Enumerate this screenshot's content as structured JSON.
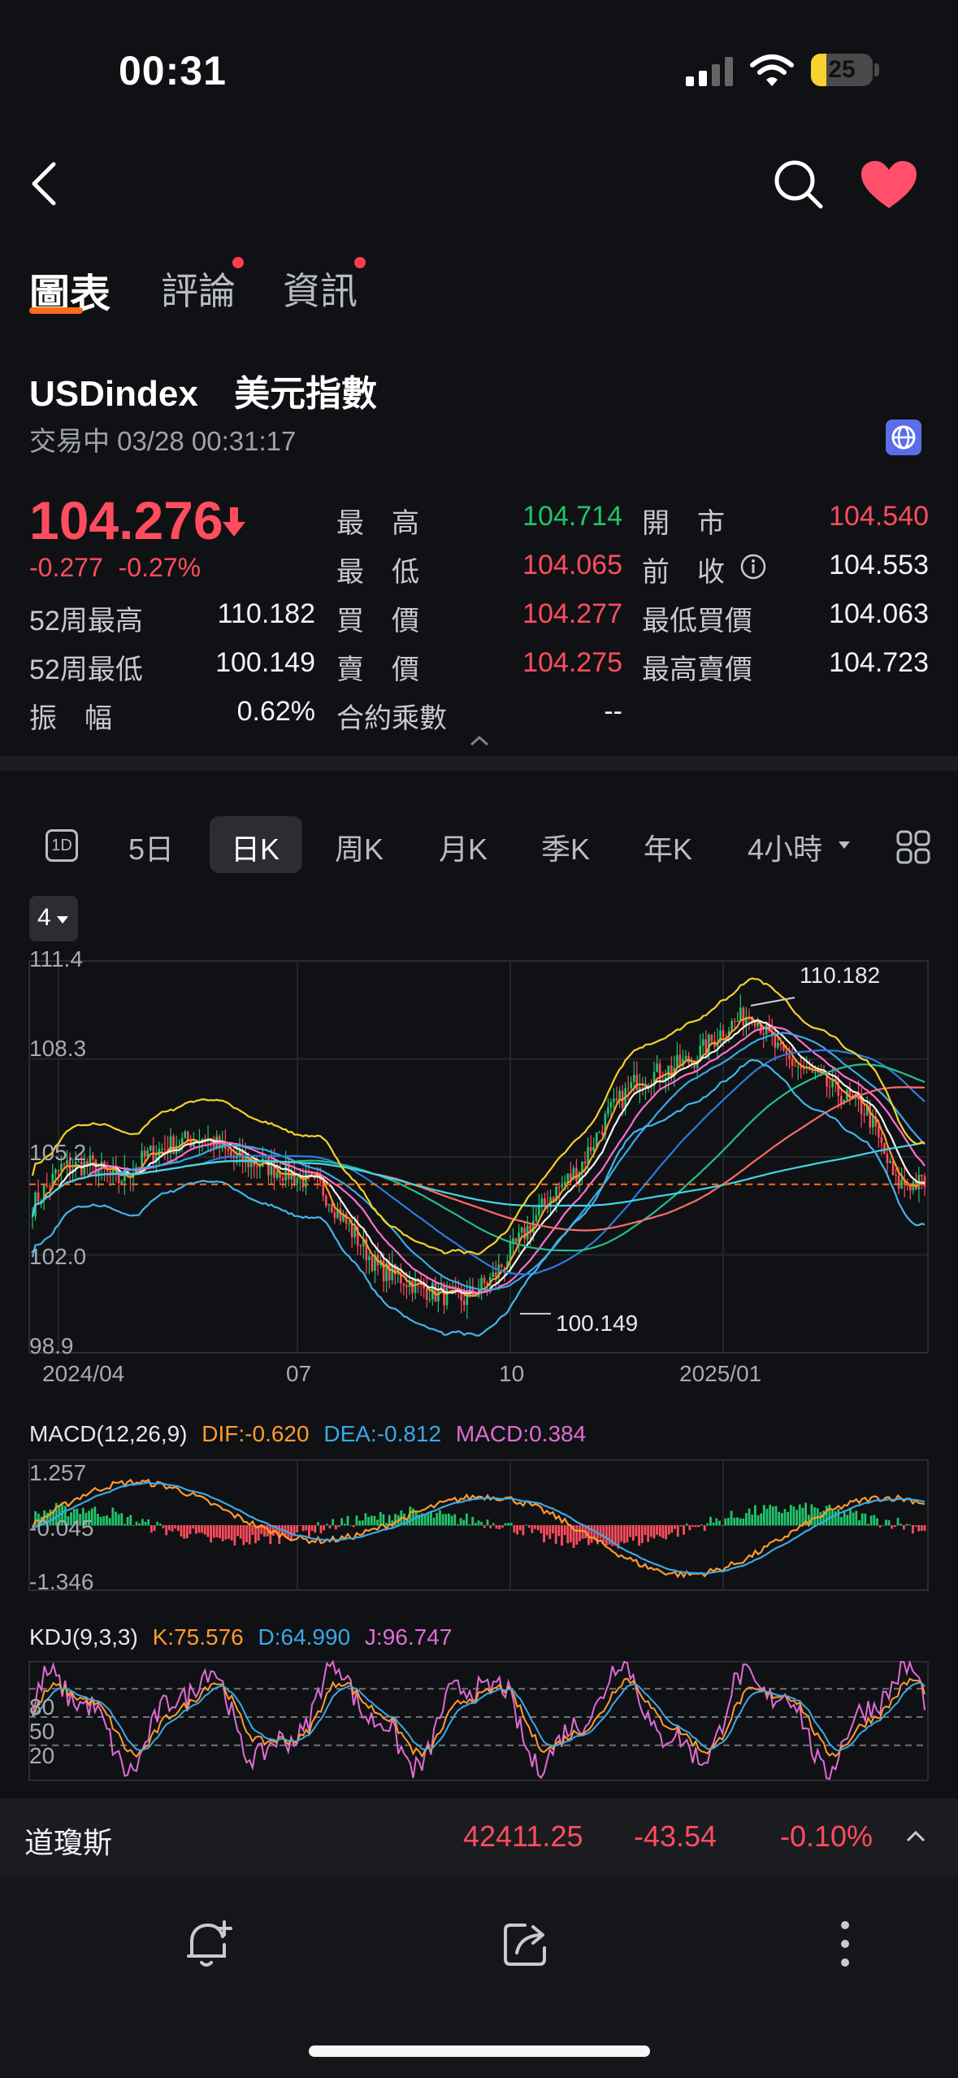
{
  "status": {
    "time": "00:31",
    "battery": "25",
    "battery_level": 0.25
  },
  "nav": {
    "tabs": [
      {
        "label": "圖表"
      },
      {
        "label": "評論"
      },
      {
        "label": "資訊"
      }
    ]
  },
  "instrument": {
    "symbol": "USDindex",
    "name": "美元指數",
    "status": "交易中 03/28 00:31:17",
    "price": "104.276",
    "change": "-0.277",
    "change_pct": "-0.27%"
  },
  "quote": {
    "high_label": "最　高",
    "high": "104.714",
    "open_label": "開　市",
    "open": "104.540",
    "low_label": "最　低",
    "low": "104.065",
    "prev_label": "前　收",
    "prev": "104.553",
    "w52_high_label": "52周最高",
    "w52_high": "110.182",
    "bid_label": "買　價",
    "bid": "104.277",
    "min_bid_label": "最低買價",
    "min_bid": "104.063",
    "w52_low_label": "52周最低",
    "w52_low": "100.149",
    "ask_label": "賣　價",
    "ask": "104.275",
    "max_ask_label": "最高賣價",
    "max_ask": "104.723",
    "amp_label": "振　幅",
    "amp": "0.62%",
    "mult_label": "合約乘數",
    "mult": "--"
  },
  "periods": {
    "icon_label": "1D",
    "items": [
      {
        "label": "5日"
      },
      {
        "label": "日K"
      },
      {
        "label": "周K"
      },
      {
        "label": "月K"
      },
      {
        "label": "季K"
      },
      {
        "label": "年K"
      },
      {
        "label": "4小時"
      }
    ],
    "active": "日K"
  },
  "indicator_selector": "4",
  "colors": {
    "up": "#21c46b",
    "down": "#ff4d5e",
    "accent": "#ff6a1a",
    "dif": "#ff9a2e",
    "dea": "#3aa8e8",
    "macd": "#e06bd6"
  },
  "chart_data": [
    {
      "type": "line",
      "series_kind": "candlestick with moving averages",
      "y_ticks": [
        "111.4",
        "108.3",
        "105.2",
        "102.0",
        "98.9"
      ],
      "ylim": [
        98.9,
        111.4
      ],
      "x_ticks": [
        "2024/04",
        "07",
        "10",
        "2025/01"
      ],
      "annotations": [
        {
          "label": "110.182",
          "value": 110.182
        },
        {
          "label": "100.149",
          "value": 100.149
        }
      ],
      "current_price": 104.276,
      "close_path": [
        [
          0,
          103.6
        ],
        [
          10,
          104.8
        ],
        [
          20,
          104.9
        ],
        [
          30,
          104.4
        ],
        [
          40,
          105.2
        ],
        [
          50,
          105.6
        ],
        [
          60,
          105.8
        ],
        [
          70,
          105.1
        ],
        [
          80,
          104.9
        ],
        [
          90,
          104.6
        ],
        [
          100,
          104.2
        ],
        [
          110,
          102.9
        ],
        [
          120,
          101.6
        ],
        [
          130,
          101.2
        ],
        [
          140,
          100.8
        ],
        [
          150,
          100.6
        ],
        [
          160,
          101.3
        ],
        [
          170,
          102.6
        ],
        [
          180,
          103.9
        ],
        [
          190,
          104.8
        ],
        [
          200,
          106.5
        ],
        [
          210,
          107.6
        ],
        [
          220,
          107.9
        ],
        [
          230,
          108.3
        ],
        [
          240,
          109.2
        ],
        [
          250,
          109.8
        ],
        [
          260,
          108.4
        ],
        [
          270,
          107.8
        ],
        [
          280,
          107.2
        ],
        [
          290,
          106.6
        ],
        [
          300,
          104.3
        ],
        [
          310,
          104.3
        ]
      ]
    },
    {
      "type": "bar",
      "title": "MACD(12,26,9)",
      "series": [
        {
          "name": "DIF",
          "value": "-0.620"
        },
        {
          "name": "DEA",
          "value": "-0.812"
        },
        {
          "name": "MACD",
          "value": "0.384"
        }
      ],
      "y_ticks": [
        "1.257",
        "-0.045",
        "-1.346"
      ],
      "ylim": [
        -1.346,
        1.257
      ]
    },
    {
      "type": "line",
      "title": "KDJ(9,3,3)",
      "series": [
        {
          "name": "K",
          "value": "75.576"
        },
        {
          "name": "D",
          "value": "64.990"
        },
        {
          "name": "J",
          "value": "96.747"
        }
      ],
      "y_ticks": [
        "80",
        "50",
        "20"
      ]
    }
  ],
  "macd_labels": {
    "title": "MACD(12,26,9)",
    "dif": "DIF:-0.620",
    "dea": "DEA:-0.812",
    "macd": "MACD:0.384"
  },
  "kdj_labels": {
    "title": "KDJ(9,3,3)",
    "k": "K:75.576",
    "d": "D:64.990",
    "j": "J:96.747"
  },
  "ticker": {
    "name": "道瓊斯",
    "price": "42411.25",
    "change": "-43.54",
    "pct": "-0.10%"
  }
}
